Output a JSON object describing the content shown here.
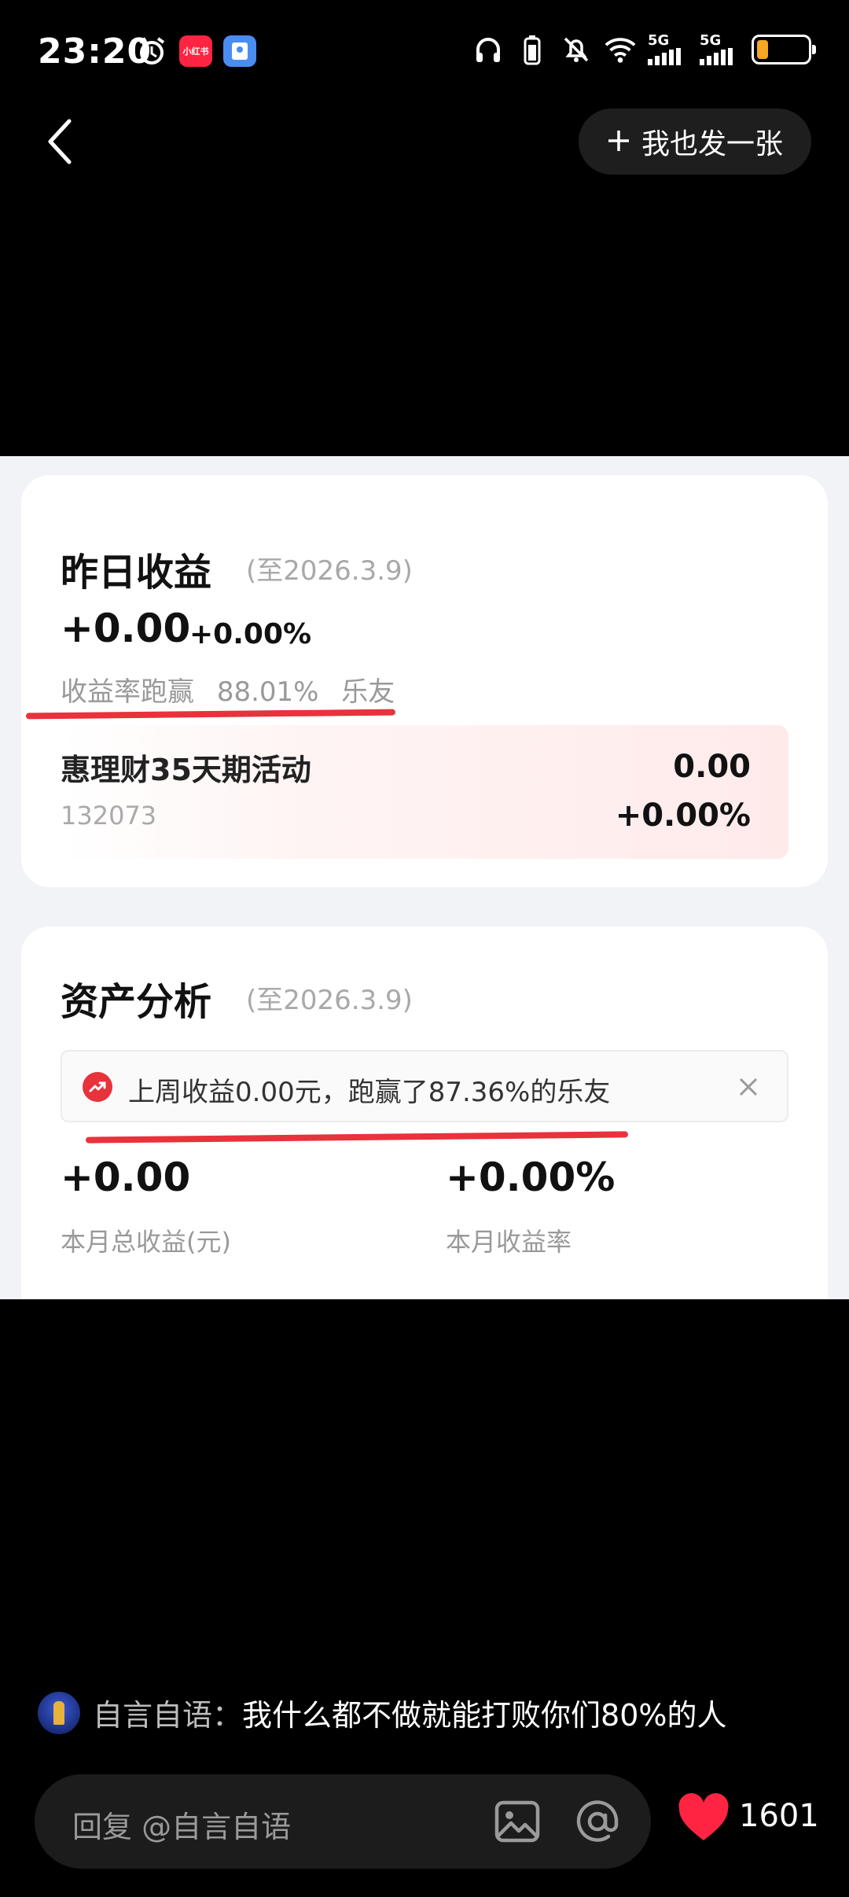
{
  "status_bar": {
    "time": "23:20",
    "app_badge_1": "小红书",
    "net_1": "5G",
    "net_2": "5G"
  },
  "top_bar": {
    "post_label": "我也发一张"
  },
  "card_yesterday": {
    "title": "昨日收益",
    "date": "(至2026.3.9)",
    "amount": "+0.00",
    "rate": "+0.00%",
    "rank_prefix": "收益率跑赢",
    "rank_value": "88.01%",
    "rank_suffix": "乐友",
    "fund": {
      "name": "惠理财35天期活动",
      "code": "132073",
      "value": "0.00",
      "rate": "+0.00%"
    }
  },
  "card_assets": {
    "title": "资产分析",
    "date": "(至2026.3.9)",
    "notice": "上周收益0.00元，跑赢了87.36%的乐友",
    "month_total_value": "+0.00",
    "month_total_label": "本月总收益(元)",
    "month_rate_value": "+0.00%",
    "month_rate_label": "本月收益率"
  },
  "comment": {
    "author": "自言自语：",
    "text": "我什么都不做就能打败你们80%的人"
  },
  "reply": {
    "placeholder": "回复 @自言自语"
  },
  "likes": {
    "count": "1601"
  },
  "colors": {
    "accent_red": "#e8323c",
    "battery": "#f5a623",
    "background": "#000000"
  }
}
